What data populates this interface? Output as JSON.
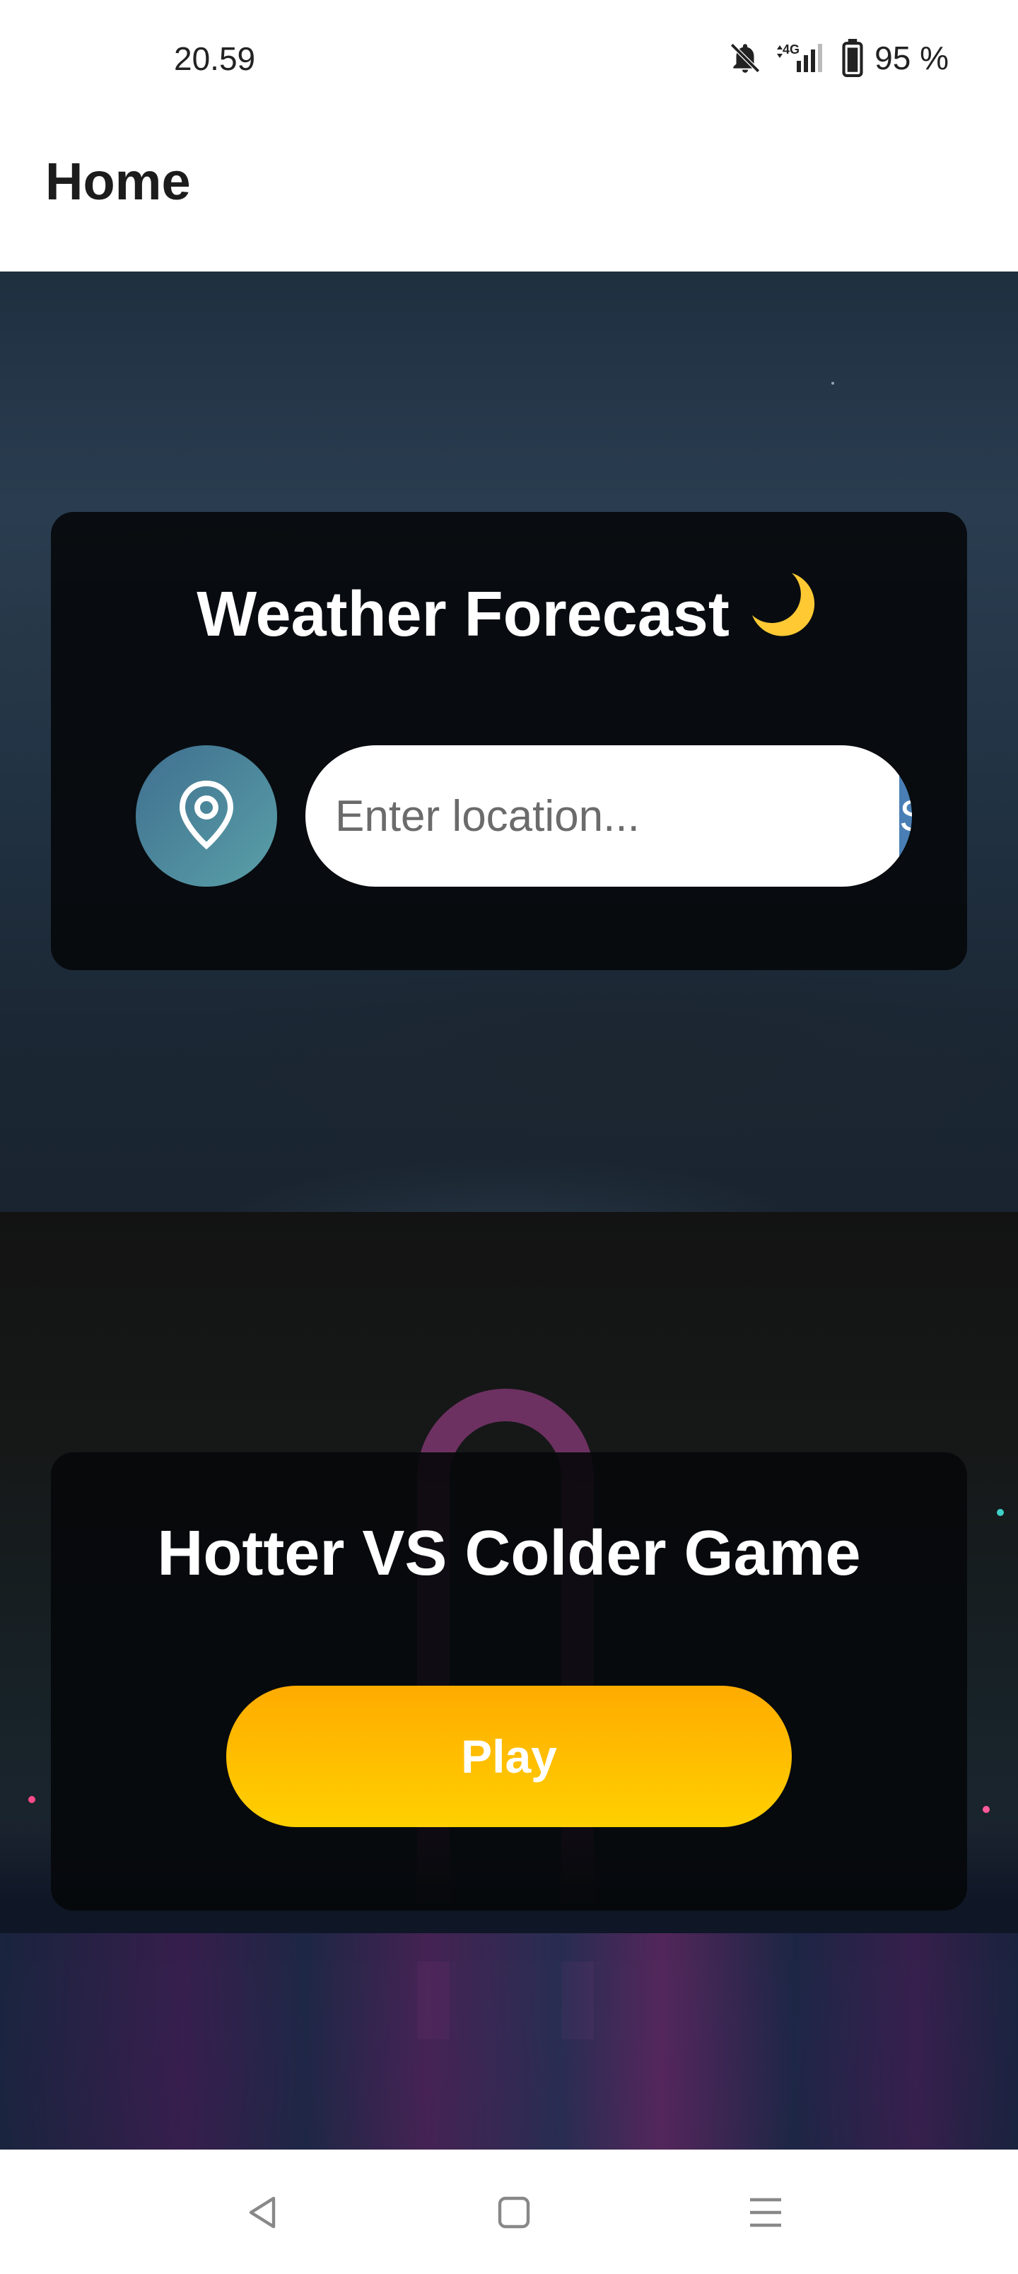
{
  "status_bar": {
    "time": "20.59",
    "battery": "95 %",
    "icons": [
      "bell-muted-icon",
      "signal-4g-icon",
      "battery-icon"
    ]
  },
  "app_bar": {
    "title": "Home"
  },
  "weather": {
    "title": "Weather Forecast",
    "title_emoji": "moon-icon",
    "location_icon": "location-pin-icon",
    "search_placeholder": "Enter location...",
    "search_value": "",
    "search_button": "Search",
    "colors": {
      "location_btn": "#4f8ca0",
      "search_btn": "#4a7fb5"
    }
  },
  "game": {
    "title": "Hotter VS Colder Game",
    "play_button": "Play",
    "colors": {
      "play_btn_top": "#ffab00",
      "play_btn_bottom": "#ffd000"
    }
  },
  "nav_bar": {
    "buttons": [
      "back-icon",
      "home-icon",
      "menu-icon"
    ]
  }
}
